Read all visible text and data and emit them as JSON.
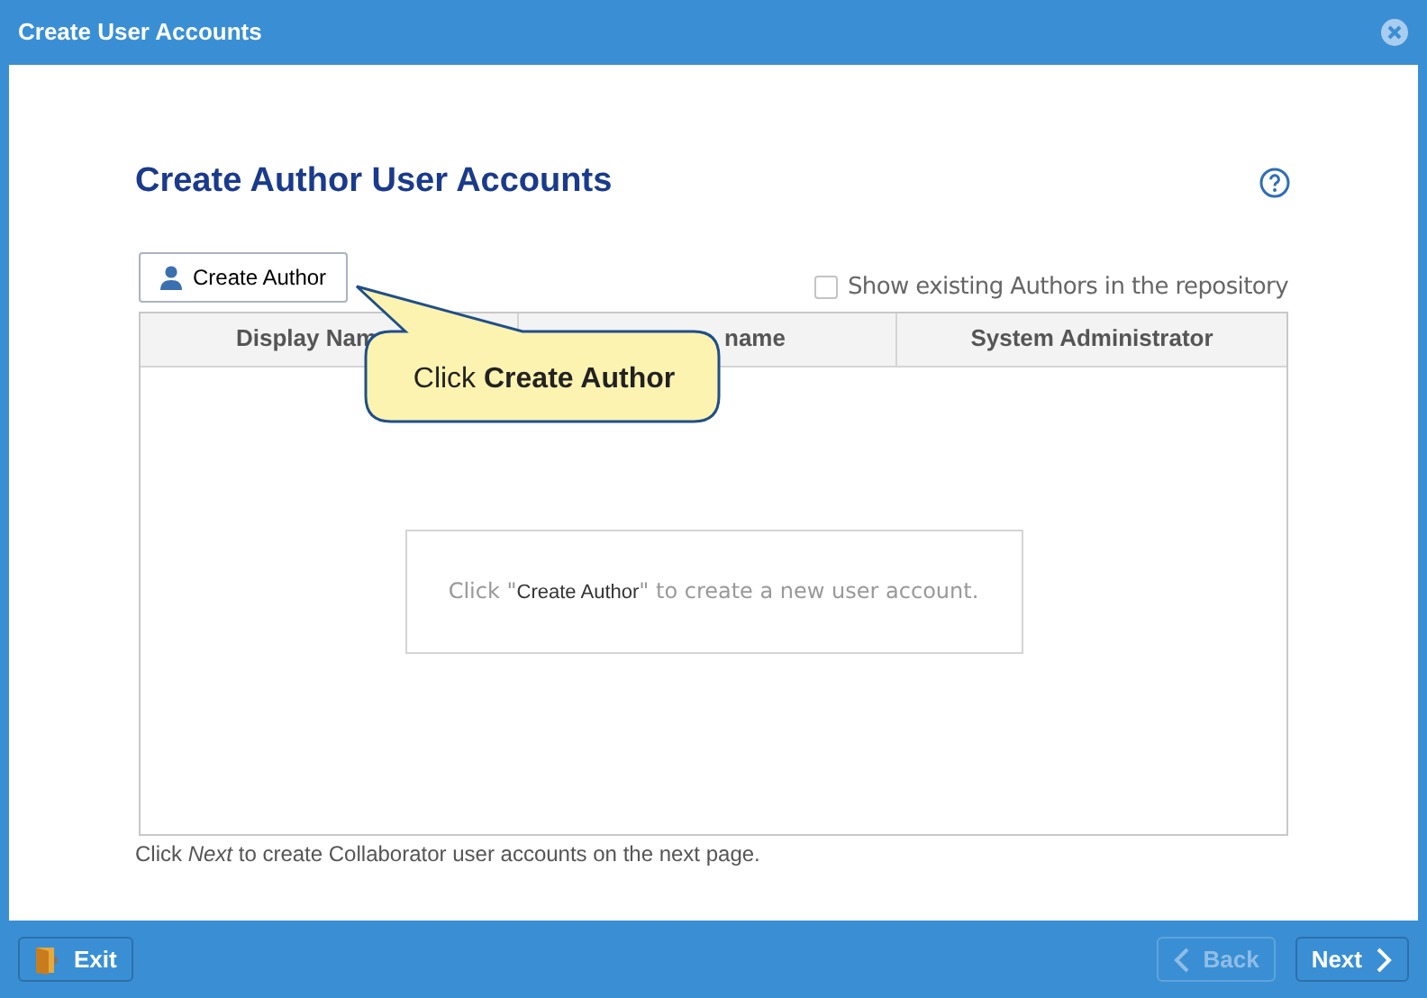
{
  "window": {
    "title": "Create User Accounts"
  },
  "heading": "Create Author User Accounts",
  "create_button": {
    "label": "Create Author"
  },
  "show_existing": {
    "label": "Show existing Authors in the repository",
    "checked": false
  },
  "table": {
    "columns": [
      "Display Nam",
      "name",
      "System Administrator"
    ],
    "empty_message_prefix": "Click \"",
    "empty_message_code": "Create Author",
    "empty_message_suffix": "\" to create a new user account."
  },
  "callout": "Click **Create Author**",
  "note": "Click *Next* to create Collaborator user accounts on the next page.",
  "footer": {
    "buttons": [
      {
        "label": "Exit",
        "kind": "exit",
        "disabled": false
      },
      {
        "label": "Back",
        "kind": "back",
        "disabled": true
      },
      {
        "label": "Next",
        "kind": "next",
        "disabled": false
      }
    ]
  }
}
